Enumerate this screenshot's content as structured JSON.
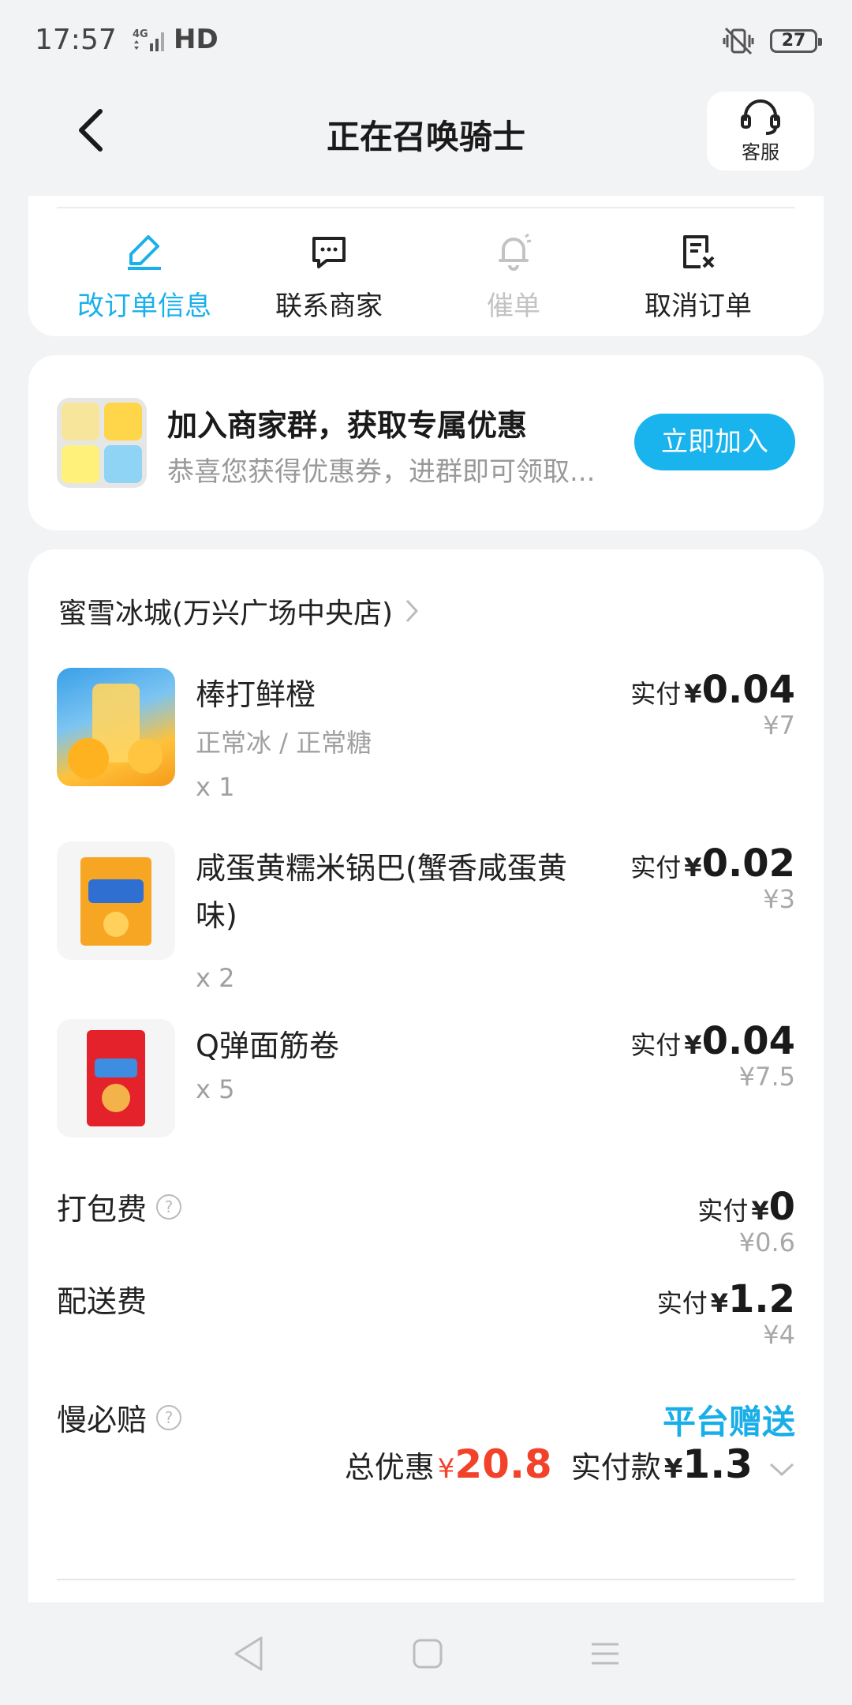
{
  "status_bar": {
    "time": "17:57",
    "network": "4G",
    "hd": "HD",
    "battery": "27",
    "icons": [
      "signal-icon",
      "vibrate-off-icon",
      "battery-icon"
    ]
  },
  "header": {
    "title": "正在召唤骑士",
    "service_label": "客服"
  },
  "actions": [
    {
      "label": "改订单信息",
      "icon": "edit-icon",
      "state": "active"
    },
    {
      "label": "联系商家",
      "icon": "chat-icon",
      "state": "normal"
    },
    {
      "label": "催单",
      "icon": "bell-icon",
      "state": "disabled"
    },
    {
      "label": "取消订单",
      "icon": "cancel-order-icon",
      "state": "normal"
    }
  ],
  "group_promo": {
    "title": "加入商家群，获取专属优惠",
    "subtitle": "恭喜您获得优惠券，进群即可领取...",
    "button": "立即加入"
  },
  "order": {
    "store_name": "蜜雪冰城(万兴广场中央店)",
    "paid_label": "实付",
    "currency": "¥",
    "items": [
      {
        "name": "棒打鲜橙",
        "spec": "正常冰 / 正常糖",
        "qty": "x 1",
        "paid": "0.04",
        "original": "¥7"
      },
      {
        "name": "咸蛋黄糯米锅巴(蟹香咸蛋黄味)",
        "spec": "",
        "qty": "x 2",
        "paid": "0.02",
        "original": "¥3"
      },
      {
        "name": "Q弹面筋卷",
        "spec": "",
        "qty": "x 5",
        "paid": "0.04",
        "original": "¥7.5"
      }
    ],
    "fees": [
      {
        "name": "打包费",
        "paid": "0",
        "original": "¥0.6"
      },
      {
        "name": "配送费",
        "paid": "1.2",
        "original": "¥4"
      }
    ],
    "insurance": {
      "name": "慢必赔",
      "value": "平台赠送"
    },
    "totals": {
      "discount_label": "总优惠",
      "discount": "20.8",
      "paid_label": "实付款",
      "paid": "1.3"
    }
  },
  "colors": {
    "accent": "#19b4ee",
    "discount_red": "#f2432a",
    "background": "#f2f3f5"
  }
}
